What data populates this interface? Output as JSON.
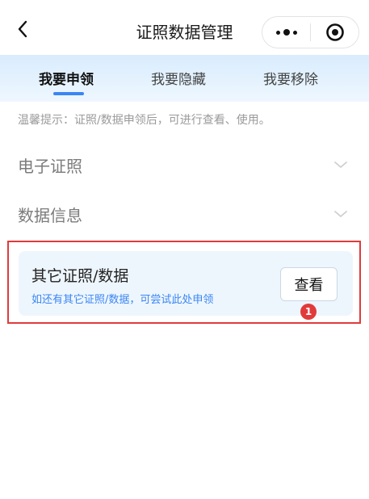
{
  "header": {
    "title": "证照数据管理",
    "back_icon": "chevron-left-icon",
    "more_icon": "more-dots-icon",
    "close_icon": "target-circle-icon"
  },
  "tabs": [
    {
      "label": "我要申领",
      "active": true
    },
    {
      "label": "我要隐藏",
      "active": false
    },
    {
      "label": "我要移除",
      "active": false
    }
  ],
  "tip": "温馨提示：证照/数据申领后，可进行查看、使用。",
  "sections": [
    {
      "label": "电子证照",
      "icon": "chevron-down-icon"
    },
    {
      "label": "数据信息",
      "icon": "chevron-down-icon"
    }
  ],
  "card": {
    "title": "其它证照/数据",
    "subtitle": "如还有其它证照/数据，可尝试此处申领",
    "button_label": "查看"
  },
  "annotation": {
    "marker": "1"
  },
  "colors": {
    "accent": "#3a86f4",
    "highlight": "#e23a3a",
    "card_bg": "#eef6fd",
    "tab_bg": "#d9ecfd"
  }
}
